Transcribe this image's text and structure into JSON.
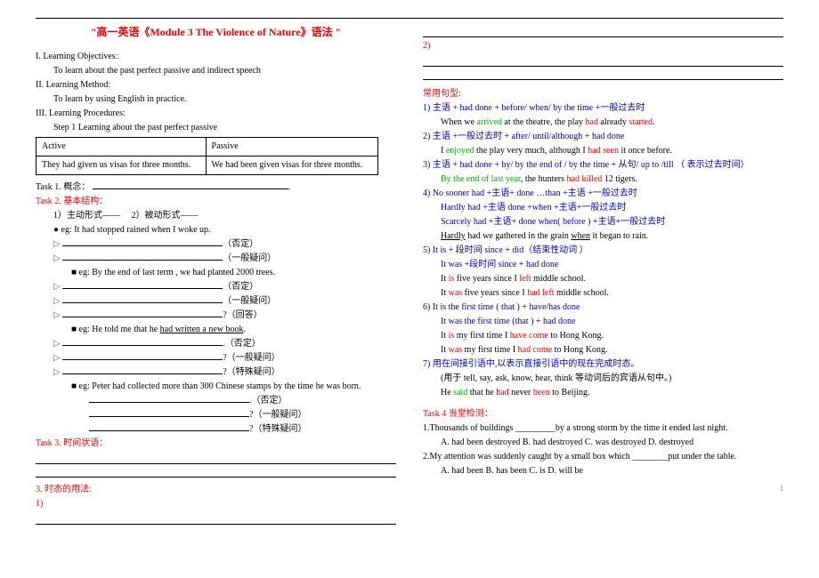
{
  "title": "\"高一英语《Module 3  The Violence of Nature》语法 \"",
  "left": {
    "objTitle": "I. Learning Objectives:",
    "objText": "To learn about the past perfect passive and indirect speech",
    "methodTitle": "II. Learning Method:",
    "methodText": "To learn by using English in practice.",
    "procTitle": "III. Learning Procedures:",
    "step1": "Step 1 Learning about the past perfect passive",
    "table": {
      "h1": "Active",
      "h2": "Passive",
      "c1": "They had given us visas for three months.",
      "c2": "We had been given visas for three months."
    },
    "task1": "Task 1. 概念：",
    "task2": "Task 2. 基本结构：",
    "t2a": "1）主动形式——",
    "t2b": "2）被动形式——",
    "eg1": "eg:  It had stopped rained when I woke up.",
    "eg1n": "（否定）",
    "eg1q": "（一般疑问）",
    "eg2": "eg:  By the end of last term , we had planted 2000 trees.",
    "eg2n": "（否定）",
    "eg2q": "（一般疑问）",
    "eg2a": "?（回答）",
    "eg3a": "eg:  He told me that he ",
    "eg3u": "had written a new book",
    "eg3b": ".",
    "eg3n": ".（否定）",
    "eg3q": "?（一般疑问）",
    "eg3s": "?（特殊疑问）",
    "eg4": "eg:  Peter had collected more than 300 Chinese stamps by the time he was born.",
    "eg4n": ".（否定）",
    "eg4q": "?（一般疑问）",
    "eg4s": "?（特殊疑问）",
    "task3": "Task 3. 时间状语：",
    "usage": "3.     时态的用法:",
    "u1": "1)"
  },
  "right": {
    "u2": "2)",
    "common": "常用句型:",
    "l1a": "1) 主语 + had done + before/ when/ by the time +一般过去时",
    "l1b1": "When we ",
    "l1b2": "arrived",
    "l1b3": " at the theatre, the play ",
    "l1b4": "had",
    "l1b5": " already ",
    "l1b6": "started",
    "l1b7": ".",
    "l2a": "2) 主语 +一般过去时 + after/ until/although + had done",
    "l2b1": "I ",
    "l2b2": "enjoyed",
    "l2b3": " the play very much, although I ",
    "l2b4": "had seen",
    "l2b5": " it once before.",
    "l3a": "3) 主语 + had done  + by/ by the end of / by the time + 从句/  up to /till （ 表示过去时间）",
    "l3b1": "By the end of last year",
    "l3b2": ", the hunters ",
    "l3b3": "had killed",
    "l3b4": " 12 tigers.",
    "l4a": "4) No sooner had +主语+ done  …than +主语 +一般过去时",
    "l4b": "Hardly had +主语 done +when +主语+一般过去时",
    "l4c": "Scarcely had +主语+ done when( before ) +主语+一般过去时",
    "l4d1": "Hardly",
    "l4d2": " had we gathered in the grain ",
    "l4d3": "when",
    "l4d4": " it began to rain.",
    "l5a": "5) It is +  段时间    since + did（结束性动词 ）",
    "l5b": "It was +段时间    since + had done",
    "l5c1": "It ",
    "l5c2": "is",
    "l5c3": " five years since I ",
    "l5c4": "left",
    "l5c5": " middle school.",
    "l5d1": "It ",
    "l5d2": "was",
    "l5d3": " five years since I ",
    "l5d4": "had left",
    "l5d5": " middle school.",
    "l6a": "6) It is the first time ( that )   + have/has done",
    "l6b": "It was the first time (that )    + had done",
    "l6c1": "It ",
    "l6c2": "is",
    "l6c3": " my first time I ",
    "l6c4": "have come",
    "l6c5": " to Hong Kong.",
    "l6d1": "It ",
    "l6d2": "was",
    "l6d3": " my first time I ",
    "l6d4": "had come",
    "l6d5": " to Hong Kong.",
    "l7a": "7) 用在间接引语中,以表示直接引语中的现在完成时态。",
    "l7b": "(用于 tell, say, ask, know, hear, think 等动词后的宾语从句中。)",
    "l7c1": "He ",
    "l7c2": "said",
    "l7c3": " that he ",
    "l7c4": "had",
    "l7c5": " never ",
    "l7c6": "been",
    "l7c7": " to Beijing.",
    "task4": "Task 4 当堂检测：",
    "q1": "1.Thousands of buildings _________by a strong storm by the time it ended last night.",
    "q1opts": "A. had been destroyed  B. had destroyed  C. was destroyed  D. destroyed",
    "q2": "2.My attention was suddenly caught by a small box which ________put under the table.",
    "q2opts": "A. had been       B. has been     C. is           D. will be",
    "pagenum": "1"
  }
}
